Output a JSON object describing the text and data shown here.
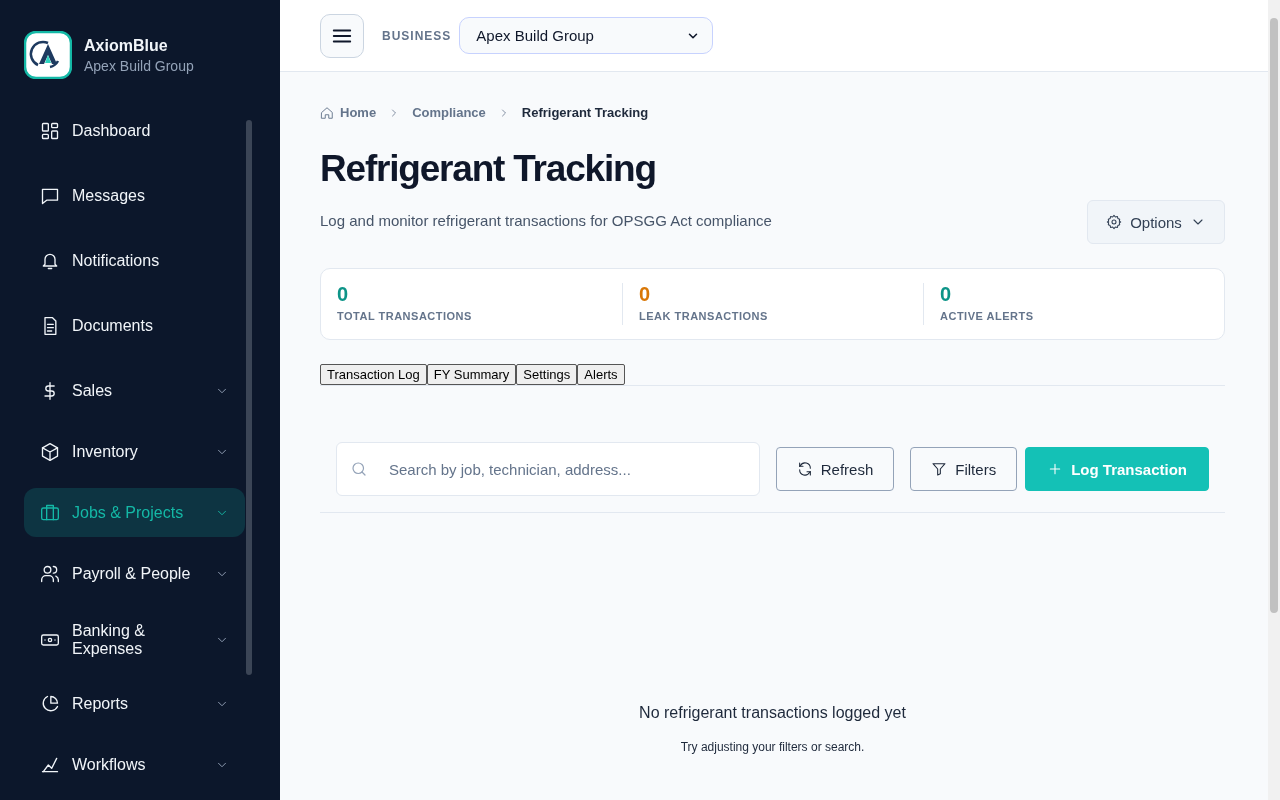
{
  "brand": {
    "name": "AxiomBlue",
    "subtitle": "Apex Build Group"
  },
  "sidebar": {
    "items": [
      {
        "label": "Dashboard",
        "expandable": false,
        "selected": false
      },
      {
        "label": "Messages",
        "expandable": false,
        "selected": false
      },
      {
        "label": "Notifications",
        "expandable": false,
        "selected": false
      },
      {
        "label": "Documents",
        "expandable": false,
        "selected": false
      },
      {
        "label": "Sales",
        "expandable": true,
        "selected": false
      },
      {
        "label": "Inventory",
        "expandable": true,
        "selected": false
      },
      {
        "label": "Jobs & Projects",
        "expandable": true,
        "selected": true
      },
      {
        "label": "Payroll & People",
        "expandable": true,
        "selected": false
      },
      {
        "label": "Banking & Expenses",
        "expandable": true,
        "selected": false
      },
      {
        "label": "Reports",
        "expandable": true,
        "selected": false
      },
      {
        "label": "Workflows",
        "expandable": true,
        "selected": false
      }
    ]
  },
  "header": {
    "business_label": "BUSINESS",
    "business_value": "Apex Build Group"
  },
  "breadcrumb": [
    "Home",
    "Compliance",
    "Refrigerant Tracking"
  ],
  "title": "Refrigerant Tracking",
  "description": "Log and monitor refrigerant transactions for OPSGG Act compliance",
  "options_button": "Options",
  "stats": [
    {
      "value": "0",
      "label": "TOTAL TRANSACTIONS",
      "color": "#0d9488"
    },
    {
      "value": "0",
      "label": "LEAK TRANSACTIONS",
      "color": "#d97706"
    },
    {
      "value": "0",
      "label": "ACTIVE ALERTS",
      "color": "#0d9488"
    }
  ],
  "tabs": [
    "Transaction Log",
    "FY Summary",
    "Settings",
    "Alerts"
  ],
  "search": {
    "placeholder": "Search by job, technician, address..."
  },
  "buttons": {
    "refresh": "Refresh",
    "filters": "Filters",
    "log": "Log Transaction"
  },
  "empty_state": {
    "title": "No refrigerant transactions logged yet",
    "hint": "Try adjusting your filters or search."
  }
}
